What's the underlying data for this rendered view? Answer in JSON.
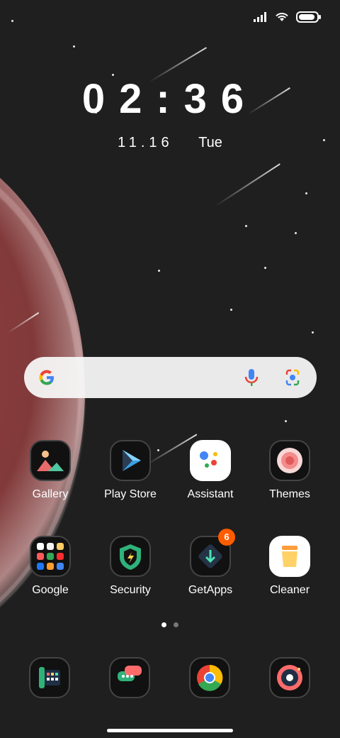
{
  "status_bar": {
    "signal": "signal-icon",
    "wifi": "wifi-icon",
    "battery": "battery-icon",
    "battery_level_percent": 85
  },
  "clock": {
    "time": "02:36",
    "date_numeric": "11.16",
    "day": "Tue"
  },
  "search": {
    "google_icon": "google-g-icon",
    "mic_icon": "mic-icon",
    "lens_icon": "lens-icon"
  },
  "apps_row1": [
    {
      "label": "Gallery",
      "icon": "gallery-icon"
    },
    {
      "label": "Play Store",
      "icon": "play-store-icon"
    },
    {
      "label": "Assistant",
      "icon": "assistant-icon"
    },
    {
      "label": "Themes",
      "icon": "themes-icon"
    }
  ],
  "apps_row2": [
    {
      "label": "Google",
      "icon": "google-folder-icon"
    },
    {
      "label": "Security",
      "icon": "security-icon"
    },
    {
      "label": "GetApps",
      "icon": "getapps-icon",
      "badge": "6"
    },
    {
      "label": "Cleaner",
      "icon": "cleaner-icon"
    }
  ],
  "dock": [
    {
      "icon": "phone-icon"
    },
    {
      "icon": "messages-icon"
    },
    {
      "icon": "chrome-icon"
    },
    {
      "icon": "camera-icon"
    }
  ],
  "page_indicator": {
    "pages": 2,
    "active_page": 1
  },
  "colors": {
    "badge": "#ff5c00",
    "background": "#1f1f1f",
    "planet": "#a44a4a"
  }
}
